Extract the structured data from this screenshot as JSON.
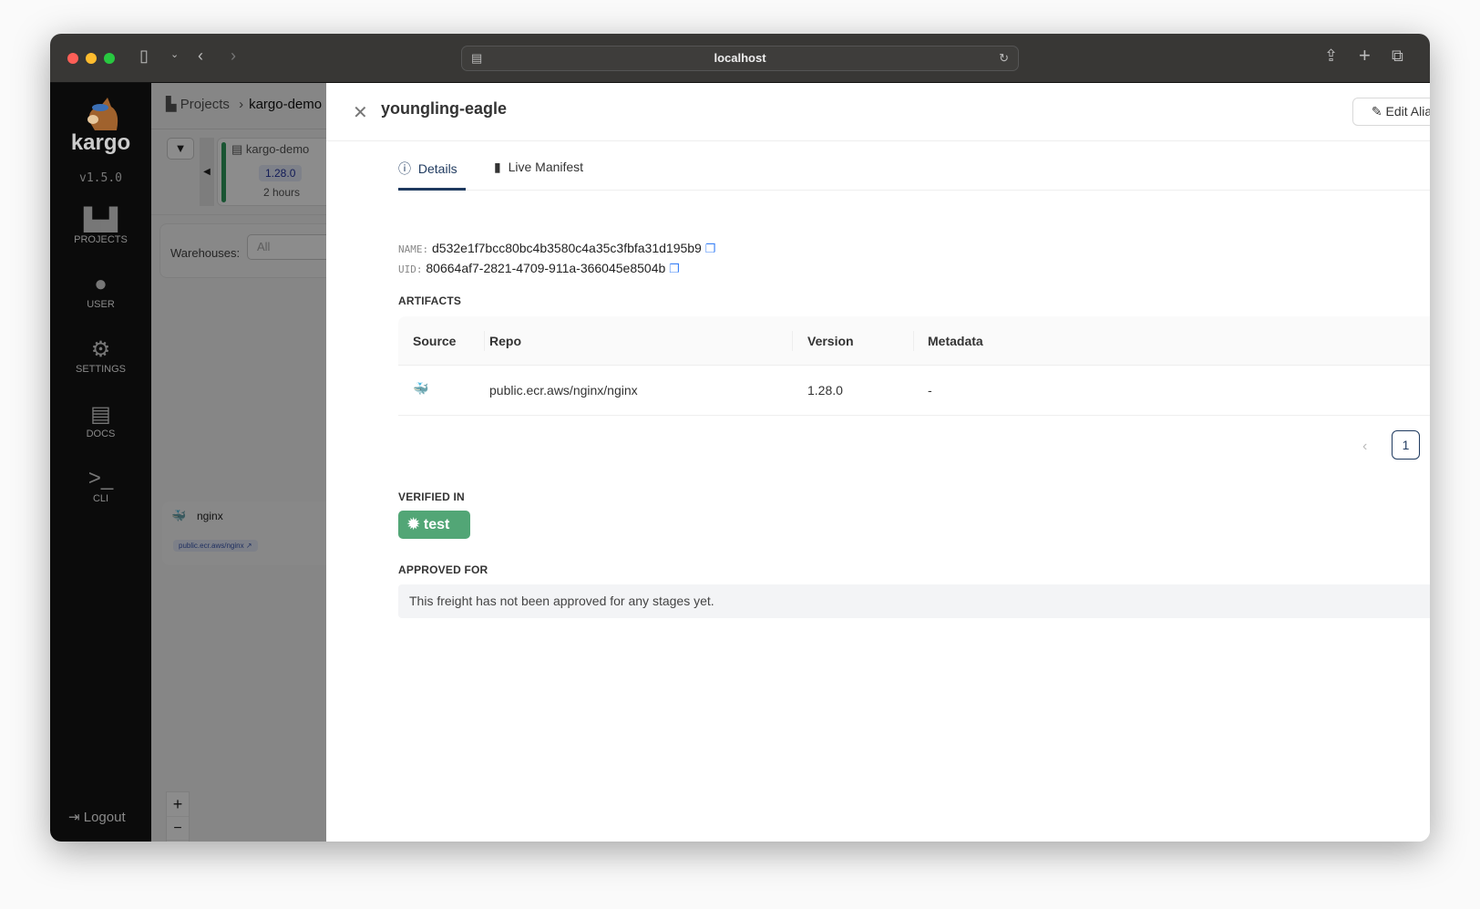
{
  "browser": {
    "url": "localhost"
  },
  "sidebar": {
    "brand": "kargo",
    "version": "v1.5.0",
    "items": [
      {
        "label": "PROJECTS",
        "icon": "projects-icon"
      },
      {
        "label": "USER",
        "icon": "user-icon"
      },
      {
        "label": "SETTINGS",
        "icon": "gear-icon"
      },
      {
        "label": "DOCS",
        "icon": "book-icon"
      },
      {
        "label": "CLI",
        "icon": "terminal-icon"
      }
    ],
    "logout": "Logout"
  },
  "background": {
    "breadcrumb": [
      "Projects",
      "kargo-demo"
    ],
    "stage_card": {
      "project": "kargo-demo",
      "version": "1.28.0",
      "age": "2 hours"
    },
    "warehouses_label": "Warehouses:",
    "warehouses_value": "All",
    "warehouse_node": {
      "name": "nginx",
      "repo": "public.ecr.aws/nginx"
    }
  },
  "drawer": {
    "title": "youngling-eagle",
    "edit_alias": "Edit Alias",
    "tabs": [
      {
        "label": "Details",
        "active": true
      },
      {
        "label": "Live Manifest",
        "active": false
      }
    ],
    "name_label": "NAME:",
    "name_value": "d532e1f7bcc80bc4b3580c4a35c3fbfa31d195b9",
    "uid_label": "UID:",
    "uid_value": "80664af7-2821-4709-911a-366045e8504b",
    "artifacts_label": "ARTIFACTS",
    "table": {
      "headers": [
        "Source",
        "Repo",
        "Version",
        "Metadata"
      ],
      "rows": [
        {
          "source_icon": "docker-icon",
          "repo": "public.ecr.aws/nginx/nginx",
          "version": "1.28.0",
          "metadata": "-"
        }
      ]
    },
    "pagination": {
      "current": "1"
    },
    "verified_label": "VERIFIED IN",
    "verified_stages": [
      "test"
    ],
    "approved_label": "APPROVED FOR",
    "approved_empty": "This freight has not been approved for any stages yet."
  },
  "colors": {
    "accent": "#1f3a5f",
    "verified": "#52a676",
    "copy": "#3b82f6"
  }
}
